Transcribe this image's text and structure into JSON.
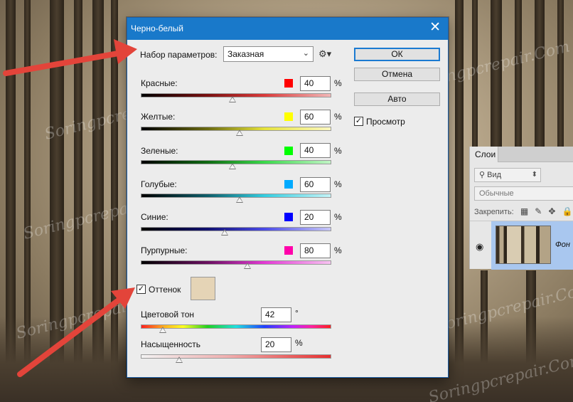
{
  "dialog": {
    "title": "Черно-белый",
    "preset_label": "Набор параметров:",
    "preset_value": "Заказная",
    "buttons": {
      "ok": "ОК",
      "cancel": "Отмена",
      "auto": "Авто"
    },
    "preview_label": "Просмотр",
    "preview_checked": true,
    "sliders": [
      {
        "label": "Красные:",
        "value": "40",
        "unit": "%",
        "swatch": "#ff0000",
        "gradient": "linear-gradient(90deg,#000 0%,#7a1010 35%,#d93a3a 65%,#f2b7b7 100%)",
        "pos": 0.48
      },
      {
        "label": "Желтые:",
        "value": "60",
        "unit": "%",
        "swatch": "#ffff00",
        "gradient": "linear-gradient(90deg,#000 0%,#6a6a10 35%,#e6e33a 65%,#fbf7c0 100%)",
        "pos": 0.52
      },
      {
        "label": "Зеленые:",
        "value": "40",
        "unit": "%",
        "swatch": "#00ff00",
        "gradient": "linear-gradient(90deg,#000 0%,#0f6a12 35%,#3ad94a 65%,#c2f5c6 100%)",
        "pos": 0.48
      },
      {
        "label": "Голубые:",
        "value": "60",
        "unit": "%",
        "swatch": "#00aaff",
        "gradient": "linear-gradient(90deg,#000 0%,#0f5e6a 35%,#34cde0 65%,#c4f3f7 100%)",
        "pos": 0.52
      },
      {
        "label": "Синие:",
        "value": "20",
        "unit": "%",
        "swatch": "#0000ff",
        "gradient": "linear-gradient(90deg,#000 0%,#101070 35%,#4a4ae6 65%,#c8c8f7 100%)",
        "pos": 0.44
      },
      {
        "label": "Пурпурные:",
        "value": "80",
        "unit": "%",
        "swatch": "#ff00aa",
        "gradient": "linear-gradient(90deg,#000 0%,#6a1060 35%,#e33ad4 65%,#f7c4f1 100%)",
        "pos": 0.56
      }
    ],
    "tint_label": "Оттенок",
    "tint_checked": true,
    "tint_color": "#e5d4b6",
    "hue_label": "Цветовой тон",
    "hue_value": "42",
    "hue_unit": "°",
    "hue_pos": 0.117,
    "saturation_label": "Насыщенность",
    "saturation_value": "20",
    "saturation_unit": "%",
    "saturation_pos": 0.2
  },
  "layers_panel": {
    "tab": "Слои",
    "kind_filter": "Вид",
    "blend_mode": "Обычные",
    "lock_label": "Закрепить:",
    "layer_name": "Фон"
  },
  "watermark": "Soringpcrepair.Com",
  "colors": {
    "title_bar": "#1979ca",
    "arrow": "#e3443a",
    "dialog_bg": "#ececec"
  }
}
